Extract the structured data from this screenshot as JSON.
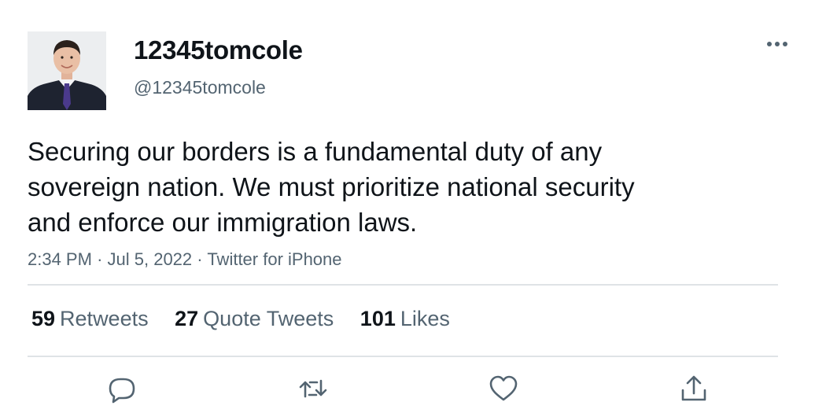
{
  "tweet": {
    "author": {
      "display_name": "12345tomcole",
      "handle": "@12345tomcole",
      "avatar_icon": "profile-photo"
    },
    "text_lines": [
      "Securing our borders is a fundamental duty of any",
      "sovereign nation. We must prioritize national security",
      "and enforce our immigration laws."
    ],
    "meta": {
      "time": "2:34 PM",
      "separator": "·",
      "date": "Jul 5, 2022",
      "source": "Twitter for iPhone"
    },
    "stats": {
      "retweets": {
        "count": "59",
        "label": "Retweets"
      },
      "quote_tweets": {
        "count": "27",
        "label": "Quote Tweets"
      },
      "likes": {
        "count": "101",
        "label": "Likes"
      }
    },
    "actions": [
      {
        "name": "reply",
        "icon": "speech-bubble-icon"
      },
      {
        "name": "retweet",
        "icon": "retweet-icon"
      },
      {
        "name": "like",
        "icon": "heart-icon"
      },
      {
        "name": "share",
        "icon": "share-icon"
      }
    ],
    "more_icon": "ellipsis-icon"
  },
  "colors": {
    "text_primary": "#0f1419",
    "text_secondary": "#536471",
    "divider": "#dfe3e6"
  }
}
